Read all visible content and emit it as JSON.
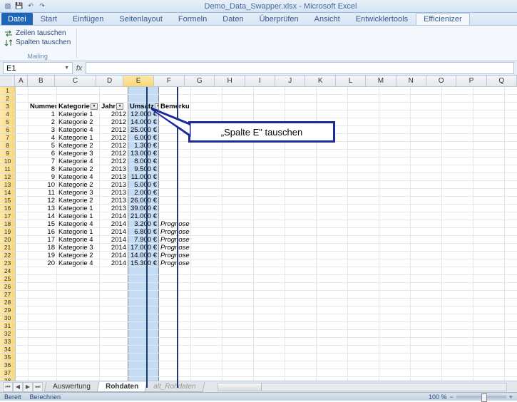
{
  "title": "Demo_Data_Swapper.xlsx - Microsoft Excel",
  "ribbon": {
    "file": "Datei",
    "tabs": [
      "Start",
      "Einfügen",
      "Seitenlayout",
      "Formeln",
      "Daten",
      "Überprüfen",
      "Ansicht",
      "Entwicklertools",
      "Efficienizer"
    ],
    "active": "Efficienizer",
    "group": {
      "item1": "Zeilen tauschen",
      "item2": "Spalten tauschen",
      "label": "Mailing"
    }
  },
  "namebox": "E1",
  "columns": [
    "A",
    "B",
    "C",
    "D",
    "E",
    "F",
    "G",
    "H",
    "I",
    "J",
    "K",
    "L",
    "M",
    "N",
    "O",
    "P",
    "Q"
  ],
  "selected_col": "E",
  "headers": {
    "B": "Nummer",
    "C": "Kategorie",
    "D": "Jahr",
    "E": "Umsatz",
    "F": "Bemerkung"
  },
  "rows": [
    {
      "n": 1,
      "k": "Kategorie 1",
      "j": 2012,
      "u": "12.000 €",
      "b": ""
    },
    {
      "n": 2,
      "k": "Kategorie 2",
      "j": 2012,
      "u": "14.000 €",
      "b": ""
    },
    {
      "n": 3,
      "k": "Kategorie 4",
      "j": 2012,
      "u": "25.000 €",
      "b": ""
    },
    {
      "n": 4,
      "k": "Kategorie 1",
      "j": 2012,
      "u": "6.000 €",
      "b": ""
    },
    {
      "n": 5,
      "k": "Kategorie 2",
      "j": 2012,
      "u": "1.300 €",
      "b": ""
    },
    {
      "n": 6,
      "k": "Kategorie 3",
      "j": 2012,
      "u": "13.000 €",
      "b": ""
    },
    {
      "n": 7,
      "k": "Kategorie 4",
      "j": 2012,
      "u": "8.000 €",
      "b": ""
    },
    {
      "n": 8,
      "k": "Kategorie 2",
      "j": 2013,
      "u": "9.500 €",
      "b": ""
    },
    {
      "n": 9,
      "k": "Kategorie 4",
      "j": 2013,
      "u": "11.000 €",
      "b": ""
    },
    {
      "n": 10,
      "k": "Kategorie 2",
      "j": 2013,
      "u": "5.000 €",
      "b": ""
    },
    {
      "n": 11,
      "k": "Kategorie 3",
      "j": 2013,
      "u": "2.000 €",
      "b": ""
    },
    {
      "n": 12,
      "k": "Kategorie 2",
      "j": 2013,
      "u": "26.000 €",
      "b": ""
    },
    {
      "n": 13,
      "k": "Kategorie 1",
      "j": 2013,
      "u": "39.000 €",
      "b": ""
    },
    {
      "n": 14,
      "k": "Kategorie 1",
      "j": 2014,
      "u": "21.000 €",
      "b": ""
    },
    {
      "n": 15,
      "k": "Kategorie 4",
      "j": 2014,
      "u": "3.200 €",
      "b": "Prognose"
    },
    {
      "n": 16,
      "k": "Kategorie 1",
      "j": 2014,
      "u": "6.800 €",
      "b": "Prognose"
    },
    {
      "n": 17,
      "k": "Kategorie 4",
      "j": 2014,
      "u": "7.900 €",
      "b": "Prognose"
    },
    {
      "n": 18,
      "k": "Kategorie 3",
      "j": 2014,
      "u": "17.000 €",
      "b": "Prognose"
    },
    {
      "n": 19,
      "k": "Kategorie 2",
      "j": 2014,
      "u": "14.000 €",
      "b": "Prognose"
    },
    {
      "n": 20,
      "k": "Kategorie 4",
      "j": 2014,
      "u": "15.300 €",
      "b": "Prognose"
    }
  ],
  "callout": "„Spalte E\" tauschen",
  "sheets": {
    "s1": "Auswertung",
    "s2": "Rohdaten",
    "s3": "alt_Rohdaten",
    "active": "Rohdaten"
  },
  "status": {
    "ready": "Bereit",
    "calc": "Berechnen",
    "zoom": "100 %"
  }
}
